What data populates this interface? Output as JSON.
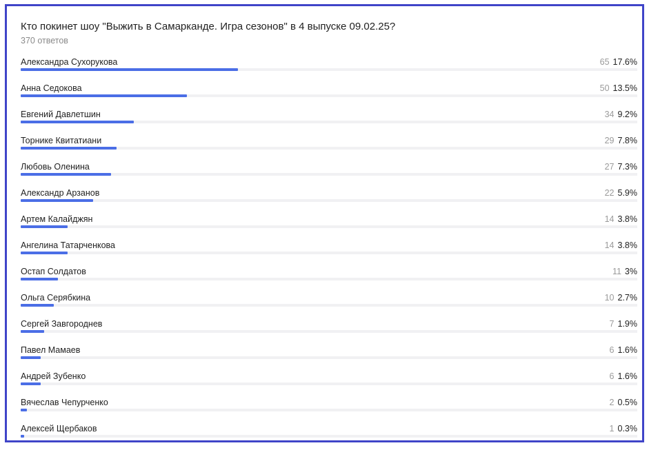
{
  "title": "Кто покинет шоу \"Выжить в Самарканде. Игра сезонов\" в 4 выпуске 09.02.25?",
  "subtitle": "370 ответов",
  "colors": {
    "bar": "#4b6ee6",
    "track": "#f1f1f3",
    "frame": "#3f44c8"
  },
  "chart_data": {
    "type": "bar",
    "orientation": "horizontal",
    "title": "Кто покинет шоу \"Выжить в Самарканде. Игра сезонов\" в 4 выпуске 09.02.25?",
    "subtitle": "370 ответов",
    "total": 370,
    "bar_scale_max_pct": 50,
    "categories": [
      "Александра Сухорукова",
      "Анна Седокова",
      "Евгений Давлетшин",
      "Торнике Квитатиани",
      "Любовь Оленина",
      "Александр Арзанов",
      "Артем Калайджян",
      "Ангелина Татарченкова",
      "Остап Солдатов",
      "Ольга Серябкина",
      "Сергей Завгороднев",
      "Павел Мамаев",
      "Андрей Зубенко",
      "Вячеслав Чепурченко",
      "Алексей Щербаков"
    ],
    "counts": [
      65,
      50,
      34,
      29,
      27,
      22,
      14,
      14,
      11,
      10,
      7,
      6,
      6,
      2,
      1
    ],
    "percent_labels": [
      "17.6%",
      "13.5%",
      "9.2%",
      "7.8%",
      "7.3%",
      "5.9%",
      "3.8%",
      "3.8%",
      "3%",
      "2.7%",
      "1.9%",
      "1.6%",
      "1.6%",
      "0.5%",
      "0.3%"
    ],
    "values": [
      17.6,
      13.5,
      9.2,
      7.8,
      7.3,
      5.9,
      3.8,
      3.8,
      3.0,
      2.7,
      1.9,
      1.6,
      1.6,
      0.5,
      0.3
    ]
  }
}
